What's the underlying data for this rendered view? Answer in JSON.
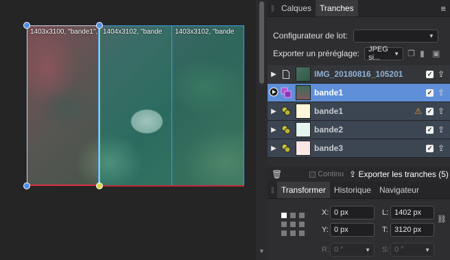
{
  "canvas": {
    "slice_labels": [
      "1403x3100, \"bande1\",",
      "1404x3102, \"bande",
      "1403x3102, \"bande"
    ]
  },
  "panel": {
    "tabs": [
      "Calques",
      "Tranches"
    ],
    "active_tab": "Tranches",
    "batch_label": "Configurateur de lot:",
    "batch_value": "",
    "preset_label": "Exporter un préréglage:",
    "preset_value": "JPEG si...",
    "layers": [
      {
        "name": "IMG_20180816_105201",
        "kind": "document"
      },
      {
        "name": "bande1",
        "kind": "slice-group",
        "selected": true
      },
      {
        "name": "bande1",
        "kind": "slice",
        "warning": true
      },
      {
        "name": "bande2",
        "kind": "slice"
      },
      {
        "name": "bande3",
        "kind": "slice"
      }
    ],
    "continu_label": "Continu",
    "export_button": "Exporter les tranches (5)",
    "bottom_tabs": [
      "Transformer",
      "Historique",
      "Navigateur"
    ],
    "active_bottom_tab": "Transformer",
    "transform": {
      "x_label": "X:",
      "x_value": "0 px",
      "y_label": "Y:",
      "y_value": "0 px",
      "w_label": "L:",
      "w_value": "1402 px",
      "h_label": "T:",
      "h_value": "3120 px",
      "r_label": "R:",
      "r_value": "0 °",
      "s_label": "S:",
      "s_value": "0 °"
    }
  },
  "colors": {
    "selected_row": "#5e8fd8",
    "slice_border": "#3f9ee8",
    "selection_bottom": "#e03040"
  }
}
